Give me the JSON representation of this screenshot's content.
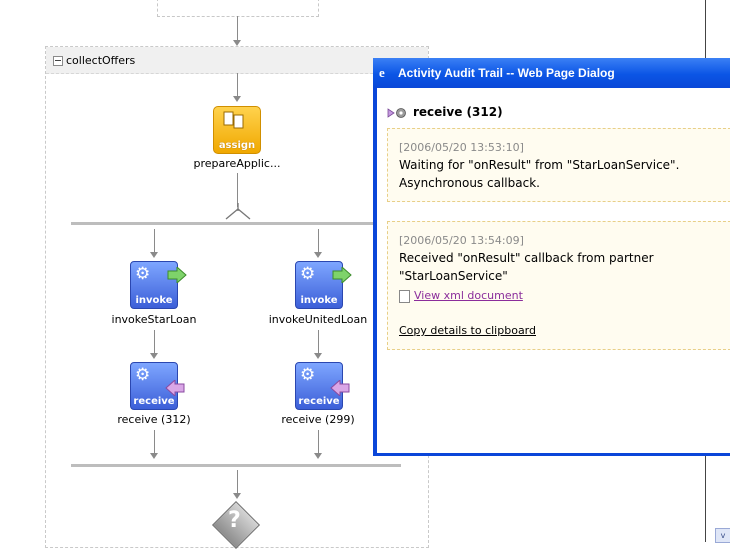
{
  "scope": {
    "title": "collectOffers"
  },
  "nodes": {
    "assign": {
      "label": "prepareApplic...",
      "tag": "assign"
    },
    "invoke_left": {
      "label": "invokeStarLoan",
      "tag": "invoke"
    },
    "invoke_right": {
      "label": "invokeUnitedLoan",
      "tag": "invoke"
    },
    "receive_left": {
      "label": "receive (312)",
      "tag": "receive"
    },
    "receive_right": {
      "label": "receive (299)",
      "tag": "receive"
    },
    "switch": {
      "symbol": "?"
    }
  },
  "dialog": {
    "title": "Activity Audit Trail -- Web Page Dialog",
    "activity_title": "receive (312)",
    "entries": [
      {
        "timestamp": "[2006/05/20 13:53:10]",
        "line1": "Waiting for \"onResult\" from \"StarLoanService\".",
        "line2": "Asynchronous callback."
      },
      {
        "timestamp": "[2006/05/20 13:54:09]",
        "line1": "Received \"onResult\" callback from partner",
        "line2": "\"StarLoanService\"",
        "link": "View xml document",
        "copy": "Copy details to clipboard"
      }
    ]
  },
  "scrollbar": {
    "down_arrow": "v"
  },
  "colors": {
    "dialog_frame": "#0a46d9",
    "assign_icon": "#f0a800",
    "activity_icon": "#3c5fd8",
    "entry_bg": "#fffcf0"
  }
}
